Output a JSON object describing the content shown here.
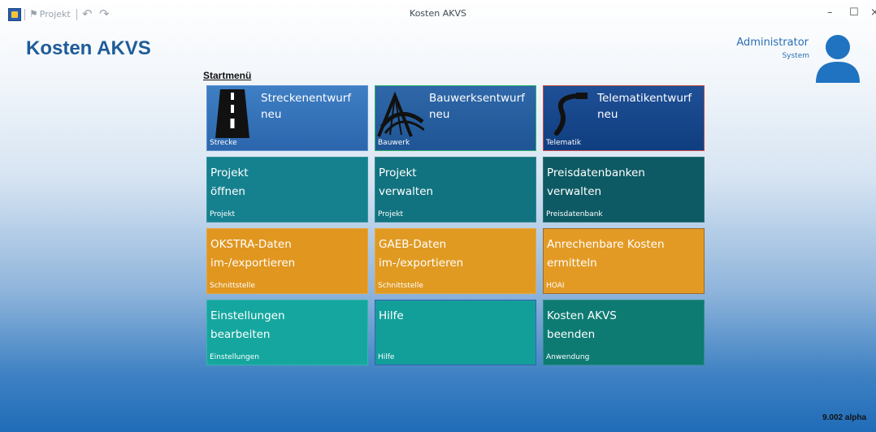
{
  "window": {
    "title": "Kosten AKVS",
    "quick_access": {
      "project_label": "Projekt"
    },
    "controls": {
      "minimize": "–",
      "maximize": "☐",
      "close": "×"
    }
  },
  "header": {
    "app_title": "Kosten AKVS",
    "user": {
      "name": "Administrator",
      "role": "System"
    }
  },
  "menu": {
    "title": "Startmenü",
    "tiles": [
      {
        "title": "Streckenentwurf\nneu",
        "subtitle": "Strecke",
        "icon": "road-icon"
      },
      {
        "title": "Bauwerksentwurf\nneu",
        "subtitle": "Bauwerk",
        "icon": "bridge-icon"
      },
      {
        "title": "Telematikentwurf\nneu",
        "subtitle": "Telematik",
        "icon": "cable-icon"
      },
      {
        "title": "Projekt\nöffnen",
        "subtitle": "Projekt"
      },
      {
        "title": "Projekt\nverwalten",
        "subtitle": "Projekt"
      },
      {
        "title": "Preisdatenbanken\nverwalten",
        "subtitle": "Preisdatenbank"
      },
      {
        "title": "OKSTRA-Daten\nim-/exportieren",
        "subtitle": "Schnittstelle"
      },
      {
        "title": "GAEB-Daten\nim-/exportieren",
        "subtitle": "Schnittstelle"
      },
      {
        "title": "Anrechenbare  Kosten\nermitteln",
        "subtitle": "HOAI"
      },
      {
        "title": "Einstellungen\nbearbeiten",
        "subtitle": "Einstellungen"
      },
      {
        "title": "Hilfe",
        "subtitle": "Hilfe"
      },
      {
        "title": "Kosten  AKVS\nbeenden",
        "subtitle": "Anwendung"
      }
    ]
  },
  "footer": {
    "version": "9.002 alpha"
  },
  "colors": {
    "accent": "#1f5c99",
    "tile_blue": "#2b66ad",
    "tile_teal": "#15818f",
    "tile_orange": "#e0961f",
    "tile_aqua": "#15a79f"
  }
}
